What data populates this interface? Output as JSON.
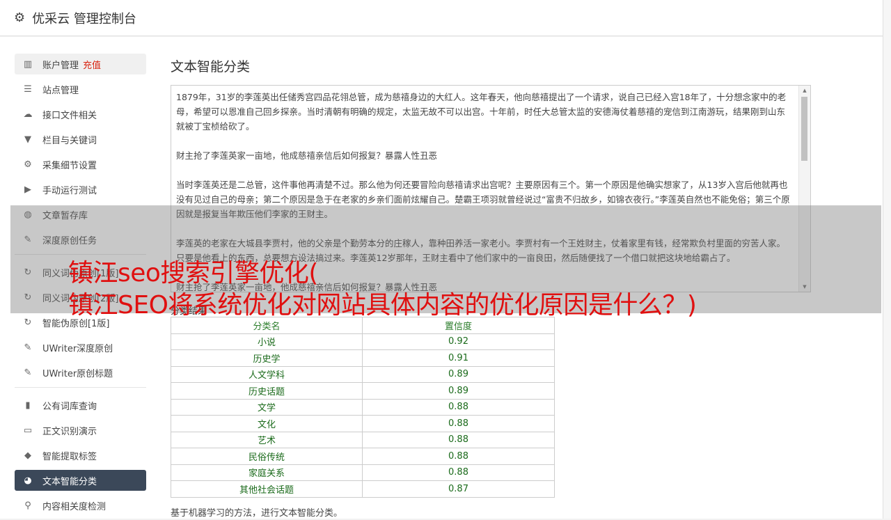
{
  "header": {
    "title": "优采云 管理控制台",
    "icon": "gear-icon"
  },
  "sidebar": {
    "group1": [
      {
        "label": "账户管理",
        "extra": "充值",
        "icon": "bar-chart-icon"
      },
      {
        "label": "站点管理",
        "icon": "list-icon"
      },
      {
        "label": "接口文件相关",
        "icon": "cloud-upload-icon"
      },
      {
        "label": "栏目与关键词",
        "icon": "filter-icon"
      },
      {
        "label": "采集细节设置",
        "icon": "gears-icon"
      },
      {
        "label": "手动运行测试",
        "icon": "play-circle-icon"
      },
      {
        "label": "文章暂存库",
        "icon": "database-icon"
      },
      {
        "label": "深度原创任务",
        "icon": "edit-icon"
      }
    ],
    "group2": [
      {
        "label": "同义词伪原创[1版]",
        "icon": "refresh-icon"
      },
      {
        "label": "同义词伪原创[2版]",
        "icon": "refresh-icon"
      },
      {
        "label": "智能伪原创[1版]",
        "icon": "refresh-icon"
      },
      {
        "label": "UWriter深度原创",
        "icon": "edit-icon"
      },
      {
        "label": "UWriter原创标题",
        "icon": "edit-icon"
      }
    ],
    "group3": [
      {
        "label": "公有词库查询",
        "icon": "book-icon"
      },
      {
        "label": "正文识别演示",
        "icon": "monitor-icon"
      },
      {
        "label": "智能提取标签",
        "icon": "tag-icon"
      },
      {
        "label": "文本智能分类",
        "icon": "pie-chart-icon"
      },
      {
        "label": "内容相关度检测",
        "icon": "search-icon"
      }
    ]
  },
  "main": {
    "title": "文本智能分类",
    "text": "1879年，31岁的李莲英出任储秀宫四品花翎总管，成为慈禧身边的大红人。这年春天，他向慈禧提出了一个请求，说自己已经入宫18年了，十分想念家中的老母，希望可以恩准自己回乡探亲。当时清朝有明确的规定，太监无故不可以出宫。十年前，时任大总管太监的安德海仗着慈禧的宠信到江南游玩，结果刚到山东就被丁宝桢给砍了。\n\n财主抢了李莲英家一亩地，他成慈禧亲信后如何报复？暴露人性丑恶\n\n当时李莲英还是二总管，这件事他再清楚不过。那么他为何还要冒险向慈禧请求出宫呢？主要原因有三个。第一个原因是他确实想家了，从13岁入宫后他就再也没有见过自己的母亲；第二个原因是急于在老家的乡亲们面前炫耀自己。楚霸王项羽就曾经说过“富贵不归故乡，如锦衣夜行。”李莲英自然也不能免俗；第三个原因就是报复当年欺压他们李家的王财主。\n\n李莲英的老家在大城县李贾村，他的父亲是个勤劳本分的庄稼人，靠种田养活一家老小。李贾村有一个王姓财主，仗着家里有钱，经常欺负村里面的穷苦人家。只要是他看上的东西，总要想方设法搞过来。李莲英12岁那年，王财主看中了他们家中的一亩良田，然后随便找了一个借口就把这块地给霸占了。\n\n财主抢了李莲英家一亩地，他成慈禧亲信后如何报复？暴露人性丑恶",
    "result_label": "分类结果",
    "table_headers": [
      "分类名",
      "置信度"
    ],
    "rows": [
      {
        "category": "小说",
        "score": "0.92"
      },
      {
        "category": "历史学",
        "score": "0.91"
      },
      {
        "category": "人文学科",
        "score": "0.89"
      },
      {
        "category": "历史话题",
        "score": "0.89"
      },
      {
        "category": "文学",
        "score": "0.88"
      },
      {
        "category": "文化",
        "score": "0.88"
      },
      {
        "category": "艺术",
        "score": "0.88"
      },
      {
        "category": "民俗传统",
        "score": "0.88"
      },
      {
        "category": "家庭关系",
        "score": "0.88"
      },
      {
        "category": "其他社会话题",
        "score": "0.87"
      }
    ],
    "footnote": "基于机器学习的方法，进行文本智能分类。"
  },
  "overlay": {
    "line1": "镇江seo搜索引擎优化(",
    "line2": "镇江SEO将系统优化对网站具体内容的优化原因是什么？)"
  },
  "colors": {
    "active_bg": "#3b4859",
    "recharge": "#d9230f",
    "overlay_text": "#e01010",
    "score_green": "#1a6a1a"
  }
}
